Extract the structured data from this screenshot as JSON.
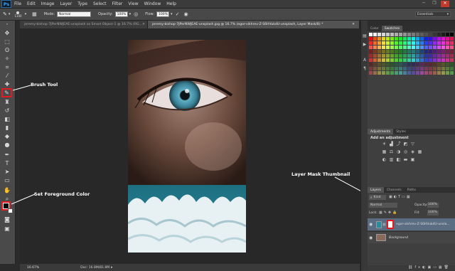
{
  "app": {
    "logo": "Ps"
  },
  "menu": [
    "File",
    "Edit",
    "Image",
    "Layer",
    "Type",
    "Select",
    "Filter",
    "View",
    "Window",
    "Help"
  ],
  "window_controls": [
    "─",
    "❐",
    "✕"
  ],
  "options": {
    "size_value": "1100",
    "mode_label": "Mode:",
    "mode_value": "Normal",
    "opacity_label": "Opacity:",
    "opacity_value": "100%",
    "flow_label": "Flow:",
    "flow_value": "100%",
    "workspace": "Essentials"
  },
  "tabs": [
    {
      "label": "jeremy-bishop-7JPerNWJEAE-unsplash as Smart Object-1 @ 16.7% (RG...",
      "active": false
    },
    {
      "label": "jeremy-bishop-7JPerNWJEAE-unsplash.jpg @ 16.7% (egor-vikhrev-Z-S6HVukdU-unsplash, Layer Mask/8) *",
      "active": true
    }
  ],
  "status": {
    "zoom": "16.67%",
    "doc": "Doc: 16.8M/81.8M"
  },
  "panels": {
    "color_tabs": [
      "Color",
      "Swatches"
    ],
    "adjust_tabs": [
      "Adjustments",
      "Styles"
    ],
    "adjust_title": "Add an adjustment",
    "layers_tabs": [
      "Layers",
      "Channels",
      "Paths"
    ],
    "kind_label": "Kind",
    "blend_mode": "Normal",
    "opacity_label": "Opacity:",
    "opacity_value": "100%",
    "lock_label": "Lock:",
    "fill_label": "Fill:",
    "fill_value": "100%",
    "layers": [
      {
        "name": "egor-vikhrev-Z-S6HVukdU-unsla..."
      },
      {
        "name": "Background"
      }
    ]
  },
  "annotations": {
    "brush": "Brush Tool",
    "foreground": "Set Foreground Color",
    "mask": "Layer Mask Thumbnail"
  },
  "colors": {
    "annotation_red": "#e01b22",
    "eye_iris": "#4a8fa3",
    "water": "#2b8a9c"
  }
}
